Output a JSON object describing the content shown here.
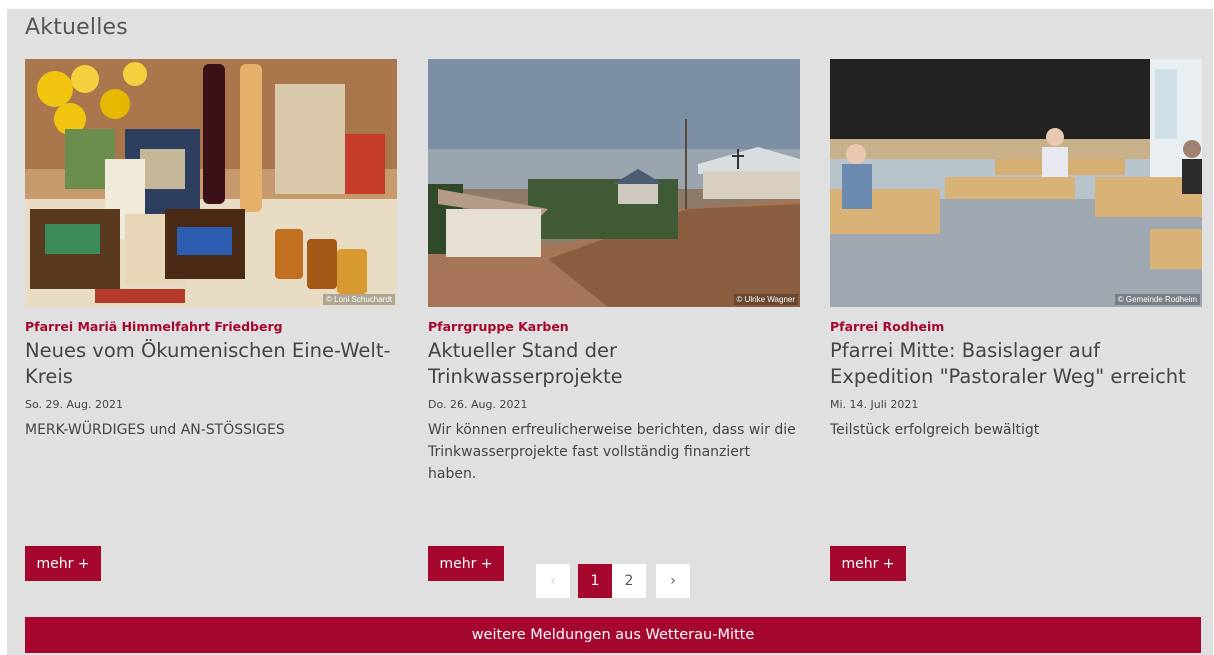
{
  "section": {
    "title": "Aktuelles"
  },
  "cards": [
    {
      "category": "Pfarrei Mariä Himmelfahrt Friedberg",
      "headline": "Neues vom Ökumenischen Eine-Welt-Kreis",
      "date": "So. 29. Aug. 2021",
      "teaser": "MERK-WÜRDIGES und AN-STÖSSIGES",
      "credit": "© Loni Schuchardt",
      "more_label": "mehr +"
    },
    {
      "category": "Pfarrgruppe Karben",
      "headline": "Aktueller Stand der Trinkwasserprojekte",
      "date": "Do. 26. Aug. 2021",
      "teaser": "Wir können erfreulicherweise berichten, dass wir die Trinkwasserprojekte fast vollständig finanziert haben.",
      "credit": "© Ulrike Wagner",
      "more_label": "mehr +"
    },
    {
      "category": "Pfarrei Rodheim",
      "headline": "Pfarrei Mitte: Basislager auf Expedition \"Pastoraler Weg\" erreicht",
      "date": "Mi. 14. Juli 2021",
      "teaser": "Teilstück erfolgreich bewältigt",
      "credit": "© Gemeinde Rodheim",
      "more_label": "mehr +"
    }
  ],
  "pagination": {
    "prev": "‹",
    "pages": [
      "1",
      "2"
    ],
    "current": "1",
    "next": "›"
  },
  "footer": {
    "more_news_label": "weitere Meldungen aus Wetterau-Mitte"
  },
  "colors": {
    "accent": "#a6072f",
    "panel": "#e0e0e0"
  }
}
